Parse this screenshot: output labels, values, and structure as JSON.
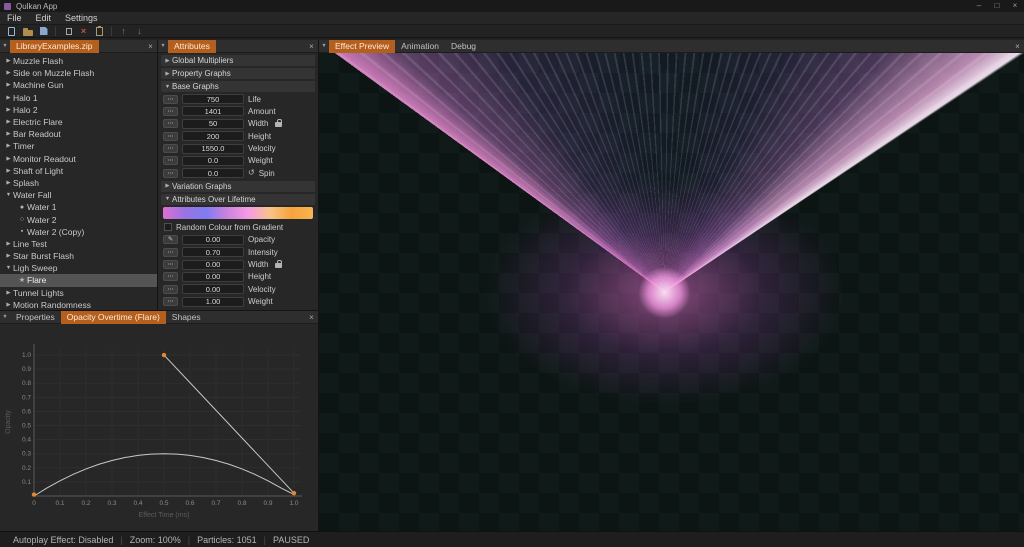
{
  "window": {
    "title": "Qulkan App",
    "controls": {
      "minimize": "–",
      "maximize": "□",
      "close": "×"
    }
  },
  "menu": {
    "items": [
      "File",
      "Edit",
      "Settings"
    ]
  },
  "toolbar": {
    "groups": [
      [
        "new-file",
        "open-file",
        "save-file"
      ],
      [
        "copy",
        "delete",
        "paste"
      ],
      [
        "move-up",
        "move-down"
      ]
    ]
  },
  "library": {
    "tab_label": "LibraryExamples.zip",
    "items": [
      {
        "label": "Muzzle Flash",
        "type": "effect",
        "depth": 0,
        "expanded": false
      },
      {
        "label": "Side on Muzzle Flash",
        "type": "effect",
        "depth": 0,
        "expanded": false
      },
      {
        "label": "Machine Gun",
        "type": "effect",
        "depth": 0,
        "expanded": false
      },
      {
        "label": "Halo 1",
        "type": "effect",
        "depth": 0,
        "expanded": false
      },
      {
        "label": "Halo 2",
        "type": "effect",
        "depth": 0,
        "expanded": false
      },
      {
        "label": "Electric Flare",
        "type": "effect",
        "depth": 0,
        "expanded": false
      },
      {
        "label": "Bar Readout",
        "type": "effect",
        "depth": 0,
        "expanded": false
      },
      {
        "label": "Timer",
        "type": "effect",
        "depth": 0,
        "expanded": false
      },
      {
        "label": "Monitor Readout",
        "type": "effect",
        "depth": 0,
        "expanded": false
      },
      {
        "label": "Shaft of Light",
        "type": "effect",
        "depth": 0,
        "expanded": false
      },
      {
        "label": "Splash",
        "type": "effect",
        "depth": 0,
        "expanded": false
      },
      {
        "label": "Water Fall",
        "type": "effect",
        "depth": 0,
        "expanded": true
      },
      {
        "label": "Water 1",
        "type": "emitter",
        "depth": 1,
        "icon": "blob"
      },
      {
        "label": "Water 2",
        "type": "emitter",
        "depth": 1,
        "icon": "ring"
      },
      {
        "label": "Water 2 (Copy)",
        "type": "emitter",
        "depth": 1,
        "icon": "box"
      },
      {
        "label": "Line Test",
        "type": "effect",
        "depth": 0,
        "expanded": false
      },
      {
        "label": "Star Burst Flash",
        "type": "effect",
        "depth": 0,
        "expanded": false
      },
      {
        "label": "Ligh Sweep",
        "type": "effect",
        "depth": 0,
        "expanded": true
      },
      {
        "label": "Flare",
        "type": "emitter",
        "depth": 1,
        "icon": "star",
        "selected": true
      },
      {
        "label": "Tunnel Lights",
        "type": "effect",
        "depth": 0,
        "expanded": false
      },
      {
        "label": "Motion Randomness",
        "type": "effect",
        "depth": 0,
        "expanded": false
      }
    ]
  },
  "attributes": {
    "tab_label": "Attributes",
    "sections": [
      {
        "label": "Global Multipliers",
        "expanded": false
      },
      {
        "label": "Property Graphs",
        "expanded": false
      },
      {
        "label": "Base Graphs",
        "expanded": true,
        "rows": [
          {
            "value": "750",
            "label": "Life"
          },
          {
            "value": "1401",
            "label": "Amount"
          },
          {
            "value": "50",
            "label": "Width",
            "lock": true
          },
          {
            "value": "200",
            "label": "Height"
          },
          {
            "value": "1550.0",
            "label": "Velocity"
          },
          {
            "value": "0.0",
            "label": "Weight"
          },
          {
            "value": "0.0",
            "label": "Spin",
            "spin": true
          }
        ]
      },
      {
        "label": "Variation Graphs",
        "expanded": false
      },
      {
        "label": "Attributes Over Lifetime",
        "expanded": true,
        "gradient_colors": [
          "#df6fd0",
          "#9a74e2",
          "#7e7cf0",
          "#cc82dd",
          "#f59ce4",
          "#f8c389",
          "#f6a23c",
          "#f8b554"
        ],
        "checkbox_label": "Random Colour from Gradient",
        "checkbox_checked": false,
        "rows": [
          {
            "value": "0.00",
            "label": "Opacity",
            "pencil": true
          },
          {
            "value": "0.70",
            "label": "Intensity"
          },
          {
            "value": "0.00",
            "label": "Width",
            "lock": true
          },
          {
            "value": "0.00",
            "label": "Height"
          },
          {
            "value": "0.00",
            "label": "Velocity"
          },
          {
            "value": "1.00",
            "label": "Weight"
          }
        ]
      }
    ]
  },
  "preview": {
    "tabs": [
      {
        "label": "Effect Preview",
        "active": true
      },
      {
        "label": "Animation",
        "active": false
      },
      {
        "label": "Debug",
        "active": false
      }
    ],
    "effect_colors": {
      "core": "#ffe2f8",
      "inner_glow": "#fa78dc",
      "edge_left": "#ff96e4",
      "edge_right": "#ffecfc",
      "fill": "#4b46a0"
    }
  },
  "graph_panel": {
    "tabs": [
      {
        "label": "Properties",
        "active": false
      },
      {
        "label": "Opacity Overtime (Flare)",
        "active": true
      },
      {
        "label": "Shapes",
        "active": false
      }
    ]
  },
  "chart_data": {
    "type": "line",
    "title": "Opacity Overtime (Flare)",
    "xlabel": "Effect Time (ms)",
    "ylabel": "Opacity",
    "xlim": [
      0,
      1.0
    ],
    "ylim": [
      0,
      1.05
    ],
    "x_ticks": [
      0,
      0.1,
      0.2,
      0.3,
      0.4,
      0.5,
      0.6,
      0.7,
      0.8,
      0.9,
      1.0
    ],
    "y_ticks": [
      0.1,
      0.2,
      0.3,
      0.4,
      0.5,
      0.6,
      0.7,
      0.8,
      0.9,
      1.0
    ],
    "grid": true,
    "series": [
      {
        "name": "opacity-curve",
        "points": [
          [
            0,
            0
          ],
          [
            0.05,
            0.057
          ],
          [
            0.1,
            0.108
          ],
          [
            0.15,
            0.153
          ],
          [
            0.2,
            0.192
          ],
          [
            0.25,
            0.225
          ],
          [
            0.3,
            0.252
          ],
          [
            0.35,
            0.273
          ],
          [
            0.4,
            0.288
          ],
          [
            0.45,
            0.297
          ],
          [
            0.5,
            0.3
          ],
          [
            0.55,
            0.297
          ],
          [
            0.6,
            0.288
          ],
          [
            0.65,
            0.273
          ],
          [
            0.7,
            0.252
          ],
          [
            0.75,
            0.225
          ],
          [
            0.8,
            0.192
          ],
          [
            0.85,
            0.153
          ],
          [
            0.9,
            0.108
          ],
          [
            0.95,
            0.057
          ],
          [
            1.0,
            0.01
          ]
        ]
      },
      {
        "name": "fade-segment",
        "points": [
          [
            0.5,
            1.0
          ],
          [
            1.0,
            0.02
          ]
        ]
      }
    ],
    "control_points": [
      [
        0,
        0.01
      ],
      [
        0.5,
        1.0
      ],
      [
        1.0,
        0.02
      ]
    ],
    "point_color": "#e2882f",
    "line_color": "#c9c9c9"
  },
  "status_bar": {
    "items": [
      "Autoplay Effect: Disabled",
      "Zoom: 100%",
      "Particles: 1051",
      "PAUSED"
    ]
  },
  "colors": {
    "accent": "#b45f1e",
    "panel_bg": "#272727",
    "header_bg": "#2e2e2e"
  }
}
